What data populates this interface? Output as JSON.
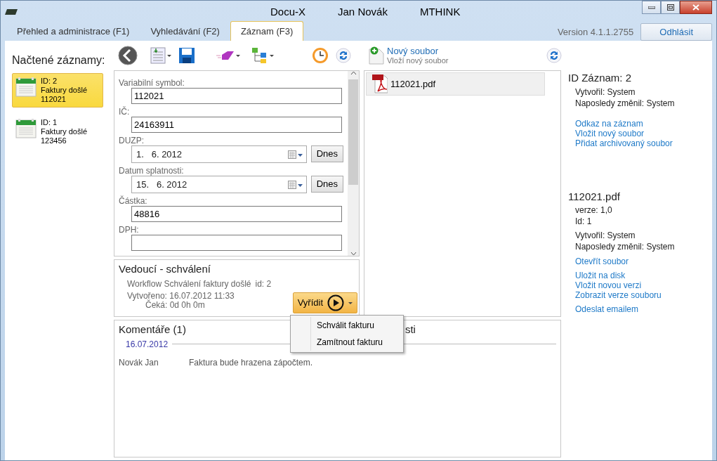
{
  "window": {
    "title": "Docu-X",
    "user": "Jan Novák",
    "company": "MTHINK"
  },
  "tabs": [
    {
      "label": "Přehled a administrace (F1)",
      "selected": false
    },
    {
      "label": "Vyhledávání (F2)",
      "selected": false
    },
    {
      "label": "Záznam (F3)",
      "selected": true
    }
  ],
  "version": "Version 4.1.1.2755",
  "logout_button": "Odhlásit",
  "sidebar": {
    "title": "Načtené záznamy:",
    "items": [
      {
        "id": "ID: 2",
        "type": "Faktury došlé",
        "number": "112021",
        "selected": true
      },
      {
        "id": "ID: 1",
        "type": "Faktury došlé",
        "number": "123456",
        "selected": false
      }
    ]
  },
  "toolbar": {
    "new_file": {
      "label": "Nový soubor",
      "hint": "Vloží nový soubor"
    }
  },
  "form": {
    "fields": [
      {
        "kind": "text",
        "label": "Variabilní symbol:",
        "value": "112021"
      },
      {
        "kind": "text",
        "label": "IČ:",
        "value": "24163911"
      },
      {
        "kind": "date",
        "label": "DUZP:",
        "value": "1.   6. 2012",
        "button": "Dnes"
      },
      {
        "kind": "date",
        "label": "Datum splatnosti:",
        "value": "15.   6. 2012",
        "button": "Dnes"
      },
      {
        "kind": "text",
        "label": "Částka:",
        "value": "48816"
      },
      {
        "kind": "text",
        "label": "DPH:"
      }
    ]
  },
  "workflow": {
    "title": "Vedoucí - schválení",
    "name": "Workflow Schválení faktury došlé",
    "id": "id: 2",
    "created": "Vytvořeno: 16.07.2012 11:33",
    "waiting": "Čeká: 0d 0h 0m",
    "action_button": "Vyřídit",
    "menu": [
      {
        "label": "Schválit fakturu"
      },
      {
        "label": "Zamítnout fakturu"
      }
    ]
  },
  "files": [
    {
      "name": "112021.pdf",
      "selected": true
    }
  ],
  "info": {
    "record_title": "ID Záznam: 2",
    "created_by": "Vytvořil: System",
    "modified_by": "Naposledy změnil: System",
    "record_links": [
      "Odkaz na záznam",
      "Vložit nový soubor",
      "Přidat archivovaný soubor"
    ],
    "file_title": "112021.pdf",
    "file_version": "verze: 1,0",
    "file_id": "Id: 1",
    "file_created_by": "Vytvořil: System",
    "file_modified_by": "Naposledy změnil: System",
    "file_link_groups": [
      [
        "Otevřít soubor"
      ],
      [
        "Uložit na disk",
        "Vložit novou verzi",
        "Zobrazit verze souboru"
      ],
      [
        "Odeslat emailem"
      ]
    ]
  },
  "comments": {
    "title": "Komentáře (1)",
    "covered_heading": "sti",
    "entries": [
      {
        "date": "16.07.2012",
        "author": "Novák Jan",
        "text": "Faktura bude hrazena zápočtem."
      }
    ]
  }
}
